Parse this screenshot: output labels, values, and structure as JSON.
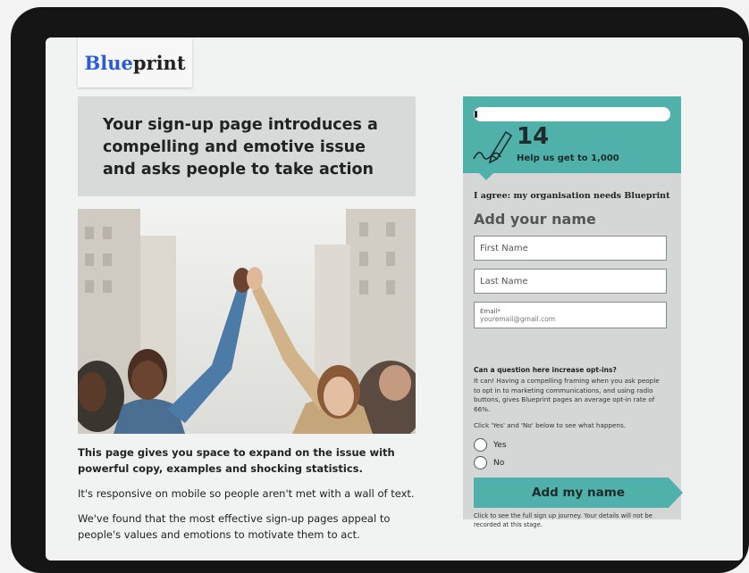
{
  "logo": {
    "part1": "Blue",
    "part2": "print"
  },
  "headline": "Your sign-up page introduces a compelling and emotive issue and asks people to take action",
  "body": {
    "lead": "This page gives you space to expand on the issue with powerful copy, examples and shocking statistics.",
    "p2": "It's responsive on mobile so people aren't met with a wall of text.",
    "p3": "We've found that the most effective sign-up pages appeal to people's values and emotions to motivate them to act."
  },
  "form": {
    "progress_fraction": 0.014,
    "count": "14",
    "count_sub": "Help us get to 1,000",
    "agree": "I agree: my organisation needs Blueprint",
    "title": "Add your name",
    "first_name_placeholder": "First Name",
    "last_name_placeholder": "Last Name",
    "email_label": "Email",
    "email_required": "*",
    "email_placeholder": "youremail@gmail.com",
    "optin_question": "Can a question here increase opt-ins?",
    "optin_text": "It can! Having a compelling framing when you ask people to opt in to marketing communications, and using radio buttons, gives Blueprint pages an average opt-in rate of 66%.",
    "optin_click": "Click 'Yes' and 'No' below to see what happens.",
    "yes_label": "Yes",
    "no_label": "No",
    "button_label": "Add my name",
    "fineprint": "Click to see the full sign up journey. Your details will not be recorded at this stage."
  },
  "colors": {
    "teal": "#4fb1aa",
    "logo_blue": "#2a5bd7",
    "panel": "#d5d6d6"
  },
  "icons": {
    "pen": "pen-signature-icon"
  }
}
